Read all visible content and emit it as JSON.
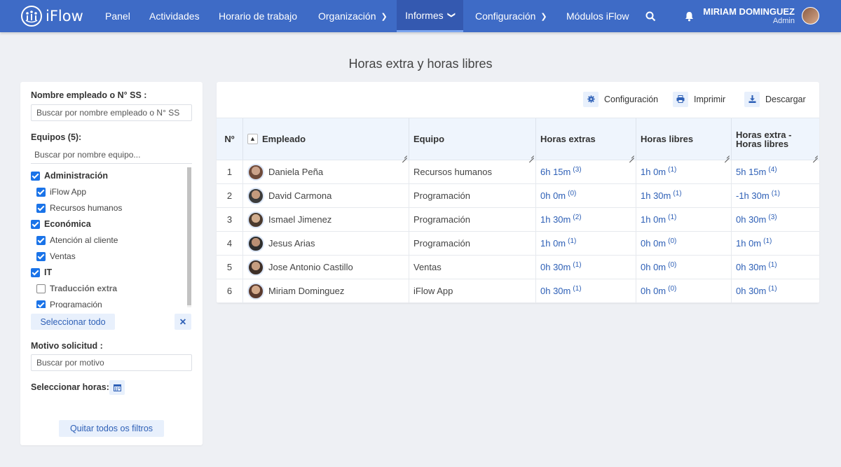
{
  "app": {
    "name": "iFlow"
  },
  "nav": {
    "items": [
      {
        "label": "Panel"
      },
      {
        "label": "Actividades"
      },
      {
        "label": "Horario de trabajo"
      },
      {
        "label": "Organización"
      },
      {
        "label": "Informes"
      },
      {
        "label": "Configuración"
      },
      {
        "label": "Módulos iFlow"
      }
    ],
    "active": "Informes"
  },
  "user": {
    "name": "MIRIAM DOMINGUEZ",
    "role": "Admin"
  },
  "page": {
    "title": "Horas extra y horas libres"
  },
  "filters": {
    "employee_label": "Nombre empleado o N° SS :",
    "employee_placeholder": "Buscar por nombre empleado o N° SS",
    "teams_label": "Equipos (5):",
    "teams_placeholder": "Buscar por nombre equipo...",
    "teams": [
      {
        "label": "Administración",
        "group": true,
        "checked": true
      },
      {
        "label": "iFlow App",
        "group": false,
        "checked": true
      },
      {
        "label": "Recursos humanos",
        "group": false,
        "checked": true
      },
      {
        "label": "Económica",
        "group": true,
        "checked": true
      },
      {
        "label": "Atención al cliente",
        "group": false,
        "checked": true
      },
      {
        "label": "Ventas",
        "group": false,
        "checked": true
      },
      {
        "label": "IT",
        "group": true,
        "checked": true
      },
      {
        "label": "Traducción extra",
        "group": false,
        "checked": false
      },
      {
        "label": "Programación",
        "group": false,
        "checked": true
      }
    ],
    "select_all": "Seleccionar todo",
    "clear_icon": "✕",
    "reason_label": "Motivo solicitud :",
    "reason_placeholder": "Buscar por motivo",
    "hours_label": "Seleccionar horas:",
    "remove_filters": "Quitar todos os filtros"
  },
  "toolbar": {
    "config": "Configuración",
    "print": "Imprimir",
    "download": "Descargar"
  },
  "table": {
    "headers": {
      "no": "Nº",
      "employee": "Empleado",
      "team": "Equipo",
      "extra": "Horas extras",
      "free": "Horas libres",
      "diff_line1": "Horas extra -",
      "diff_line2": "Horas libres"
    },
    "rows": [
      {
        "no": "1",
        "employee": "Daniela Peña",
        "team": "Recursos humanos",
        "extra": "6h 15m",
        "extra_n": "(3)",
        "free": "1h 0m",
        "free_n": "(1)",
        "diff": "5h 15m",
        "diff_n": "(4)"
      },
      {
        "no": "2",
        "employee": "David Carmona",
        "team": "Programación",
        "extra": "0h 0m",
        "extra_n": "(0)",
        "free": "1h 30m",
        "free_n": "(1)",
        "diff": "-1h 30m",
        "diff_n": "(1)"
      },
      {
        "no": "3",
        "employee": "Ismael Jimenez",
        "team": "Programación",
        "extra": "1h 30m",
        "extra_n": "(2)",
        "free": "1h 0m",
        "free_n": "(1)",
        "diff": "0h 30m",
        "diff_n": "(3)"
      },
      {
        "no": "4",
        "employee": "Jesus Arias",
        "team": "Programación",
        "extra": "1h 0m",
        "extra_n": "(1)",
        "free": "0h 0m",
        "free_n": "(0)",
        "diff": "1h 0m",
        "diff_n": "(1)"
      },
      {
        "no": "5",
        "employee": "Jose Antonio Castillo",
        "team": "Ventas",
        "extra": "0h 30m",
        "extra_n": "(1)",
        "free": "0h 0m",
        "free_n": "(0)",
        "diff": "0h 30m",
        "diff_n": "(1)"
      },
      {
        "no": "6",
        "employee": "Miriam Dominguez",
        "team": "iFlow App",
        "extra": "0h 30m",
        "extra_n": "(1)",
        "free": "0h 0m",
        "free_n": "(0)",
        "diff": "0h 30m",
        "diff_n": "(1)"
      }
    ]
  },
  "colors": {
    "navbar": "#3e6bc6",
    "accent": "#2d5fb6",
    "checkbox": "#1a73e8"
  },
  "icons": [
    "iflow-logo-icon",
    "chevron-right-icon",
    "chevron-down-icon",
    "search-icon",
    "bell-icon",
    "gear-icon",
    "print-icon",
    "download-icon",
    "calendar-icon",
    "close-icon",
    "sort-up-icon"
  ]
}
